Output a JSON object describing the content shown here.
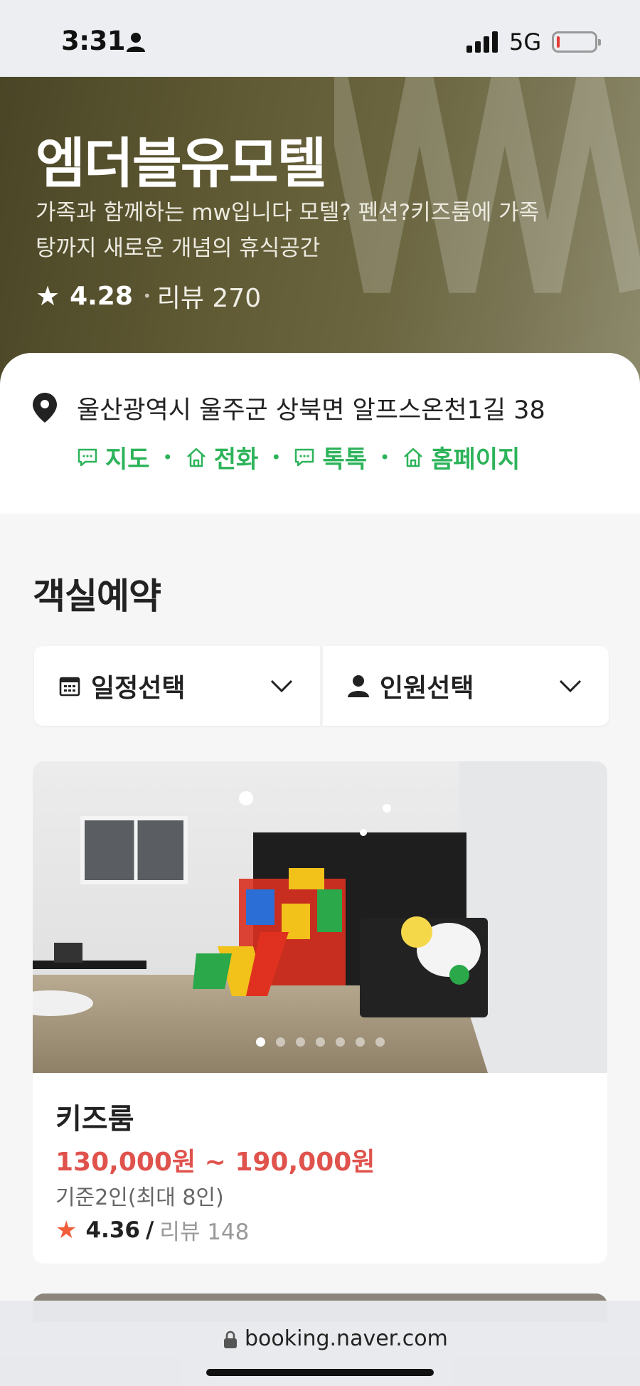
{
  "status_bar": {
    "time": "3:31",
    "network": "5G",
    "icons": [
      "person-icon",
      "signal-icon",
      "battery-icon"
    ]
  },
  "hero": {
    "title": "엠더블유모텔",
    "description": "가족과 함께하는 mw입니다 모텔? 펜션?키즈룸에 가족탕까지 새로운 개념의 휴식공간",
    "rating": "4.28",
    "reviews": "리뷰 270"
  },
  "address": {
    "text": "울산광역시 울주군 상북면 알프스온천1길 38",
    "links": [
      {
        "label": "지도",
        "icon": "chat-icon"
      },
      {
        "label": "전화",
        "icon": "home-icon"
      },
      {
        "label": "톡톡",
        "icon": "chat-icon"
      },
      {
        "label": "홈페이지",
        "icon": "home-icon"
      }
    ]
  },
  "booking": {
    "section_title": "객실예약",
    "date_selector": "일정선택",
    "person_selector": "인원선택"
  },
  "room": {
    "name": "키즈룸",
    "price": "130,000원 ~ 190,000원",
    "capacity": "기준2인(최대 8인)",
    "rating": "4.36",
    "separator": "/",
    "reviews": "리뷰 148",
    "photo_count": 7,
    "photo_active_index": 0
  },
  "url_bar": {
    "url": "booking.naver.com"
  },
  "colors": {
    "accent_green": "#2db35a",
    "price_red": "#e0524c",
    "star_orange": "#f05f3a"
  }
}
